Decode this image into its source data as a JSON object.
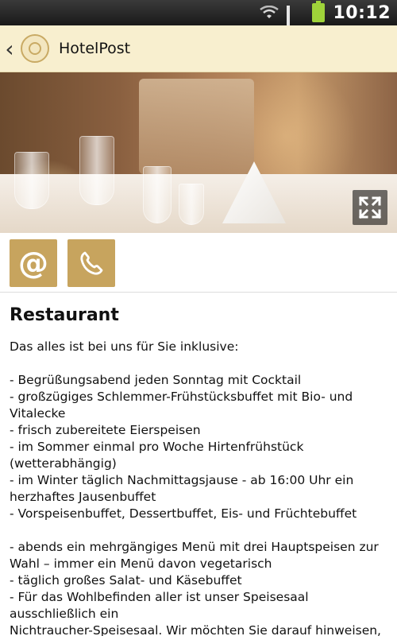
{
  "status_bar": {
    "time": "10:12",
    "icons": [
      "wifi-icon",
      "signal-icon",
      "battery-icon"
    ]
  },
  "app_header": {
    "title": "HotelPost",
    "back_icon": "chevron-left-icon",
    "logo_icon": "hotel-logo-icon"
  },
  "hero": {
    "expand_icon": "expand-icon"
  },
  "actions": {
    "email_icon": "at-sign-icon",
    "email_glyph": "@",
    "phone_icon": "phone-icon"
  },
  "content": {
    "title": "Restaurant",
    "intro": "Das alles ist bei uns für Sie inklusive:",
    "lines_block1": [
      "- Begrüßungsabend jeden Sonntag mit Cocktail",
      "- großzügiges Schlemmer-Frühstücksbuffet mit Bio- und",
      "Vitalecke",
      "- frisch zubereitete Eierspeisen",
      "- im Sommer einmal pro Woche Hirtenfrühstück",
      "(wetterabhängig)",
      "- im Winter täglich Nachmittagsjause - ab 16:00 Uhr ein",
      "herzhaftes Jausenbuffet",
      "- Vorspeisenbuffet, Dessertbuffet, Eis- und Früchtebuffet"
    ],
    "lines_block2": [
      "- abends ein mehrgängiges Menü mit drei Hauptspeisen zur",
      "Wahl – immer ein Menü davon vegetarisch",
      "- täglich großes Salat- und Käsebuffet",
      "- Für das Wohlbefinden aller ist unser Speisesaal",
      "ausschließlich ein",
      "Nichtraucher-Speisesaal. Wir möchten Sie darauf hinweisen,"
    ]
  },
  "colors": {
    "header_bg": "#f8efcf",
    "accent_gold": "#c7a45e"
  }
}
